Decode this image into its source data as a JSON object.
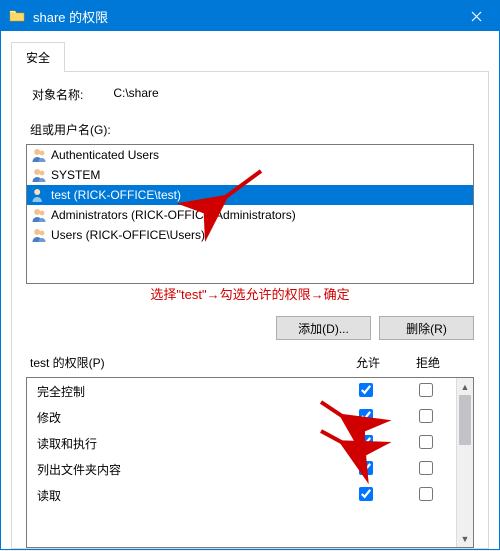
{
  "window": {
    "title": "share 的权限"
  },
  "tab": {
    "security": "安全"
  },
  "object_label": "对象名称:",
  "object_value": "C:\\share",
  "groups_label": "组或用户名(G):",
  "users": [
    {
      "label": "Authenticated Users",
      "selected": false,
      "type": "group"
    },
    {
      "label": "SYSTEM",
      "selected": false,
      "type": "group"
    },
    {
      "label": "test (RICK-OFFICE\\test)",
      "selected": true,
      "type": "user"
    },
    {
      "label": "Administrators (RICK-OFFICE\\Administrators)",
      "selected": false,
      "type": "group"
    },
    {
      "label": "Users (RICK-OFFICE\\Users)",
      "selected": false,
      "type": "group"
    }
  ],
  "annotation": "选择\"test\"→勾选允许的权限→确定",
  "buttons": {
    "add": "添加(D)...",
    "remove": "删除(R)"
  },
  "perms_title": "test 的权限(P)",
  "cols": {
    "allow": "允许",
    "deny": "拒绝"
  },
  "permissions": [
    {
      "name": "完全控制",
      "allow": true,
      "deny": false
    },
    {
      "name": "修改",
      "allow": true,
      "deny": false
    },
    {
      "name": "读取和执行",
      "allow": true,
      "deny": false
    },
    {
      "name": "列出文件夹内容",
      "allow": true,
      "deny": false
    },
    {
      "name": "读取",
      "allow": true,
      "deny": false
    }
  ]
}
